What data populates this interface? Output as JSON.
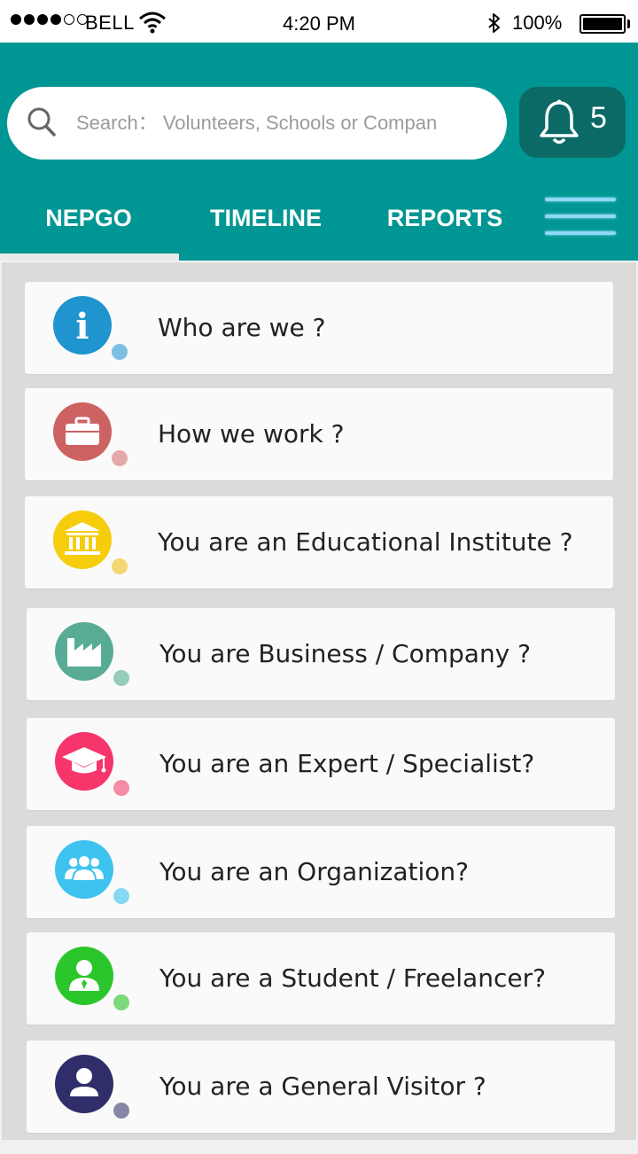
{
  "status_bar": {
    "carrier": "BELL",
    "time": "4:20 PM",
    "battery": "100%",
    "battery_level": 1.0,
    "signal_bars": 3,
    "signal_total": 5
  },
  "search": {
    "placeholder": "Search： Volunteers, Schools or Compan",
    "icon": "search-icon"
  },
  "notifications": {
    "count": "5",
    "icon": "bell-icon"
  },
  "tabs": [
    {
      "label": "NEPGO",
      "active": true
    },
    {
      "label": "TIMELINE",
      "active": false
    },
    {
      "label": "REPORTS",
      "active": false
    }
  ],
  "menu": {
    "icon": "hamburger-menu-icon"
  },
  "colors": {
    "header": "#009693",
    "bell_button": "#0b6a66"
  },
  "items": [
    {
      "label": "Who are we ?",
      "icon": "info-icon",
      "color": "#1f94cf",
      "dot": "#7dc0e2"
    },
    {
      "label": "How we work ?",
      "icon": "briefcase-icon",
      "color": "#cd6262",
      "dot": "#e4a9ab"
    },
    {
      "label": "You are an Educational Institute ?",
      "icon": "institution-icon",
      "color": "#f6cd0c",
      "dot": "#f4d774"
    },
    {
      "label": "You are Business / Company ?",
      "icon": "factory-icon",
      "color": "#58ab94",
      "dot": "#95ccbb"
    },
    {
      "label": "You are an Expert / Specialist?",
      "icon": "graduation-cap-icon",
      "color": "#f6356b",
      "dot": "#f58ba5"
    },
    {
      "label": "You are an Organization?",
      "icon": "group-icon",
      "color": "#3ec3f0",
      "dot": "#86d8f4"
    },
    {
      "label": "You are a Student / Freelancer?",
      "icon": "student-icon",
      "color": "#2bc62b",
      "dot": "#7cd97b"
    },
    {
      "label": "You are a General Visitor ?",
      "icon": "user-icon",
      "color": "#2f2e6a",
      "dot": "#8686a8"
    }
  ]
}
